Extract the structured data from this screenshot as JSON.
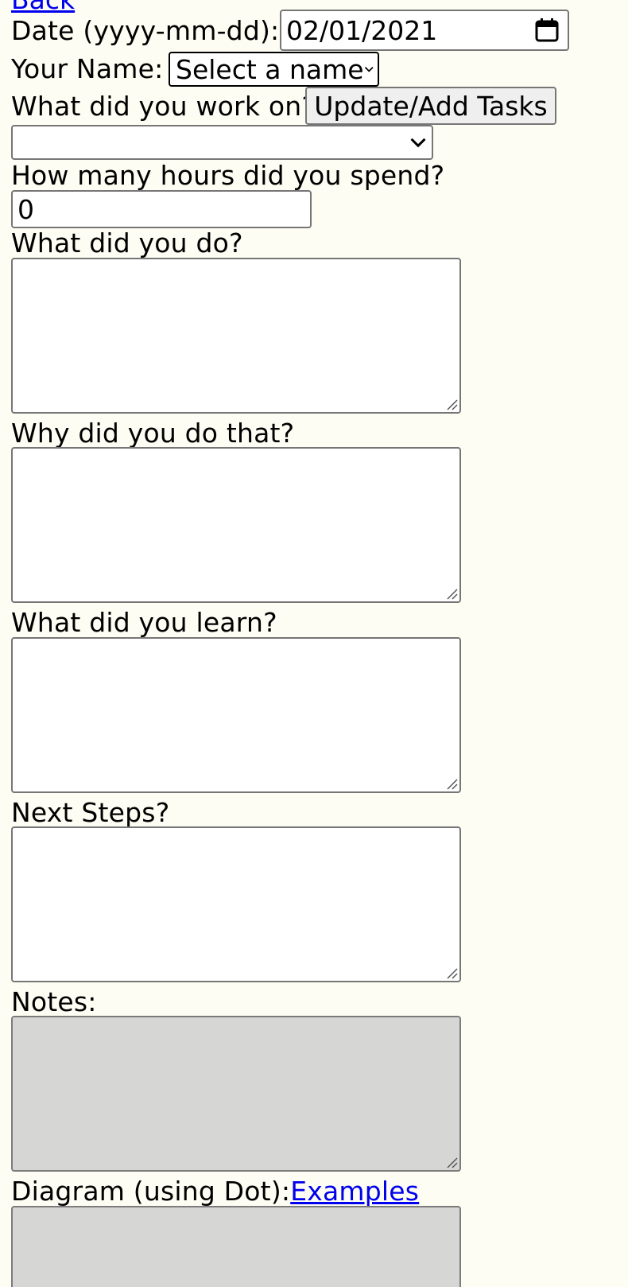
{
  "nav": {
    "back_label": "Back"
  },
  "form": {
    "date_label": "Date (yyyy-mm-dd):",
    "date_value": "02/01/2021",
    "name_label": "Your Name:",
    "name_selected": "Select a name",
    "worked_on_label": "What did you work on?",
    "update_tasks_label": "Update/Add Tasks",
    "task_selected": "",
    "hours_label": "How many hours did you spend?",
    "hours_value": "0",
    "did_label": "What did you do?",
    "why_label": "Why did you do that?",
    "learn_label": "What did you learn?",
    "next_label": "Next Steps?",
    "notes_label": "Notes:",
    "diagram_label": "Diagram (using Dot):",
    "examples_label": "Examples"
  },
  "icons": {
    "date_picker": "calendar-icon",
    "dropdown": "chevron-down-icon",
    "resize": "resize-grip-icon"
  },
  "colors": {
    "page_background": "#fdfdf3",
    "link": "#0000ee",
    "disabled_field": "#d6d6d5"
  }
}
